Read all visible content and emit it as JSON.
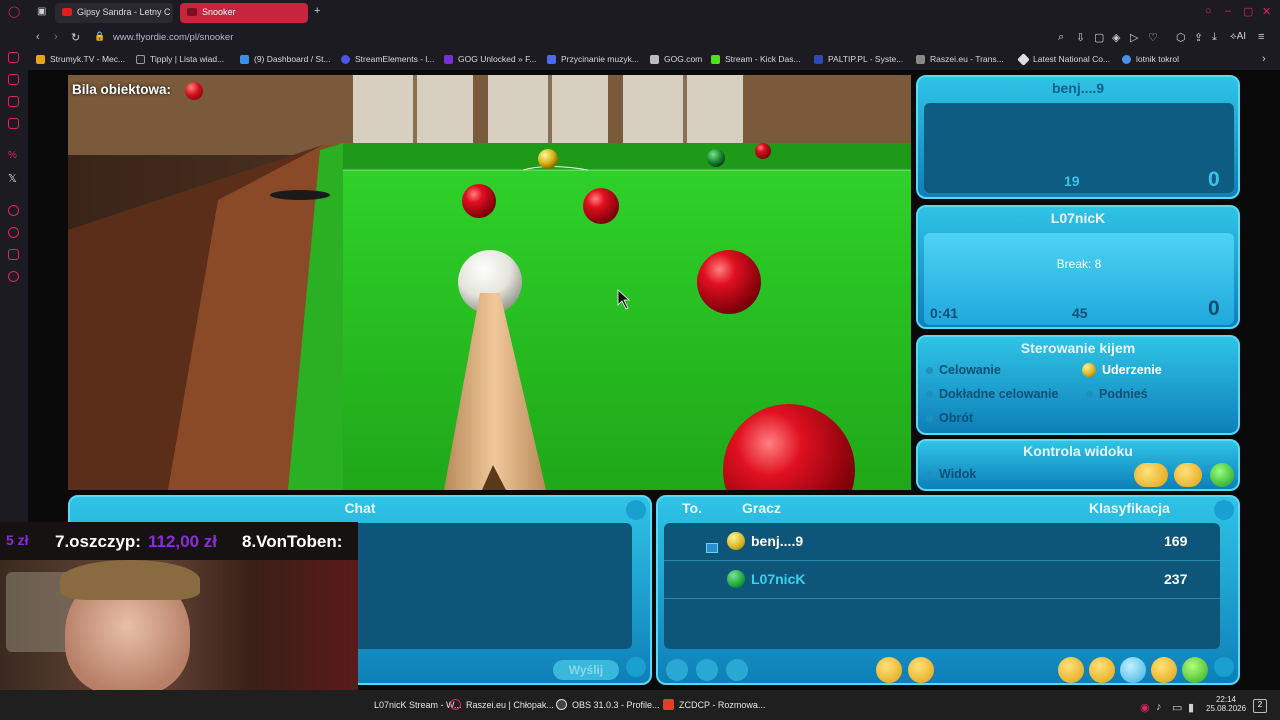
{
  "browser": {
    "tabs": [
      {
        "label": "Gipsy Sandra - Letny C"
      },
      {
        "label": "Snooker"
      }
    ],
    "url": "www.flyordie.com/pl/snooker",
    "bookmarks": [
      "Strumyk.TV - Mec...",
      "Tipply | Lista wiad...",
      "(9) Dashboard / St...",
      "StreamElements - l...",
      "GOG Unlocked » F...",
      "Przycinanie muzyk...",
      "GOG.com",
      "Stream - Kick Das...",
      "PALTIP.PL - Syste...",
      "Raszei.eu - Trans...",
      "Latest National Co...",
      "lotnik tokrol"
    ]
  },
  "game": {
    "object_ball_label": "Bila obiektowa:",
    "player1": {
      "name": "benj....9",
      "score_break": "19",
      "frames": "0"
    },
    "player2": {
      "name": "L07nicK",
      "break_label": "Break: 8",
      "timer": "0:41",
      "score": "45",
      "frames": "0"
    },
    "cue_control": {
      "title": "Sterowanie kijem",
      "options": [
        "Celowanie",
        "Uderzenie",
        "Dokładne celowanie",
        "Podnieś",
        "Obrót"
      ],
      "selected": "Uderzenie"
    },
    "view_control": {
      "title": "Kontrola widoku",
      "option": "Widok"
    },
    "chat": {
      "title": "Chat",
      "send_label": "Wyślij"
    },
    "table": {
      "col_to": "To.",
      "col_player": "Gracz",
      "col_rank": "Klasyfikacja",
      "rows": [
        {
          "name": "benj....9",
          "rank": "169",
          "ball": "#e6c21a"
        },
        {
          "name": "L07nicK",
          "rank": "237",
          "ball": "#18a83a"
        }
      ]
    }
  },
  "overlay": {
    "alert1_prefix": "7.oszczyp:",
    "alert1_value": "112,00 zł",
    "alert2": "8.VonToben:",
    "alert_left": "5 zł"
  },
  "taskbar": {
    "items": [
      "L07nicK Stream - W...",
      "Raszei.eu | Chłopak...",
      "OBS 31.0.3 - Profile...",
      "ZCDCP - Rozmowa..."
    ],
    "time": "22:14",
    "date": "25.08.2026",
    "notif": "2"
  },
  "colors": {
    "accent": "#2fc4e6",
    "felt": "#22c31a",
    "red_ball": "#c8101a"
  }
}
